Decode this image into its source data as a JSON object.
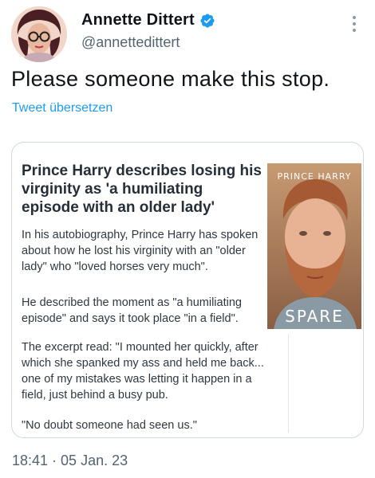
{
  "tweet": {
    "author_name": "Annette Dittert",
    "author_handle": "@annettedittert",
    "text": "Please someone make this stop.",
    "translate_label": "Tweet übersetzen",
    "timestamp": "18:41 · 05 Jan. 23"
  },
  "article": {
    "headline": "Prince Harry describes losing his virginity as 'a humiliating episode with an older lady'",
    "paragraphs": [
      "In his autobiography, Prince Harry has spoken about how he lost his virginity with an \"older lady\" who \"loved horses very much\".",
      "He described the moment as \"a humiliating episode\" and says it took place \"in a field\".",
      "The excerpt read: \"I mounted her quickly, after which she spanked my ass and held me back... one of my mistakes was letting it happen in a field, just behind a busy pub.",
      "\"No doubt someone had seen us.\""
    ],
    "book_author": "PRINCE HARRY",
    "book_title": "SPARE"
  },
  "icons": {
    "verified": "verified-badge-icon",
    "more": "more-options-icon"
  },
  "colors": {
    "link": "#1d9bf0",
    "verified": "#1d9bf0",
    "secondary_text": "#536471"
  }
}
